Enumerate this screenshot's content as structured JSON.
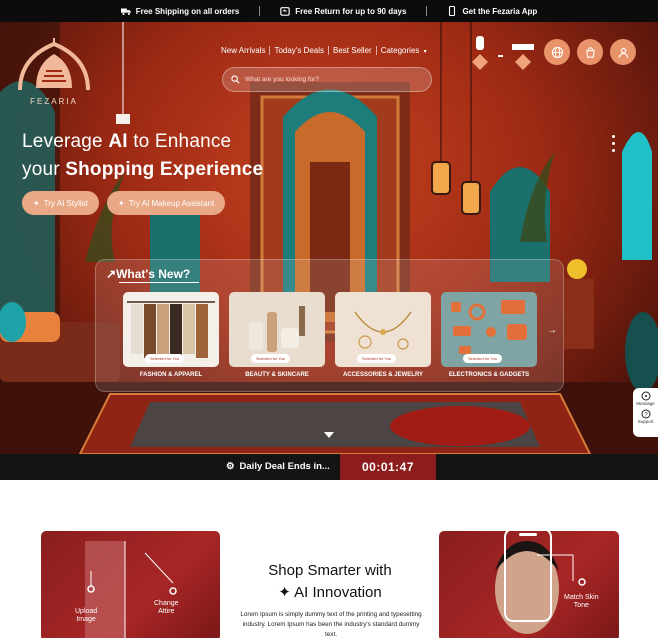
{
  "topbar": {
    "items": [
      {
        "label": "Free Shipping on all orders",
        "icon": "truck-icon"
      },
      {
        "label": "Free Return for up to 90 days",
        "icon": "return-box-icon"
      },
      {
        "label": "Get the Fezaria App",
        "icon": "phone-icon"
      }
    ]
  },
  "brand": {
    "name": "FEZARIA"
  },
  "nav": {
    "items": [
      "New Arrivals",
      "Today's Deals",
      "Best Seller",
      "Categories"
    ]
  },
  "search": {
    "placeholder": "What are you looking for?"
  },
  "hero": {
    "line1_pre": "Leverage ",
    "line1_bold": "AI",
    "line1_post": " to Enhance",
    "line2_pre": "your ",
    "line2_bold": "Shopping Experience",
    "cta1": "Try AI Stylist",
    "cta2": "Try AI Makeup Assistant"
  },
  "whats_new": {
    "title": "What's New?",
    "cards": [
      {
        "label": "FASHION & APPAREL",
        "tag": "Selected for You"
      },
      {
        "label": "BEAUTY & SKINCARE",
        "tag": "Selected for You"
      },
      {
        "label": "ACCESSORIES & JEWELRY",
        "tag": "Selected for You"
      },
      {
        "label": "ELECTRONICS & GADGETS",
        "tag": "Selected for You"
      }
    ]
  },
  "side": {
    "message": "Message",
    "support": "Support"
  },
  "deal": {
    "label": "Daily Deal Ends in...",
    "timer": "00:01:47"
  },
  "lower": {
    "upload": "Upload\nImage",
    "change": "Change\nAttire",
    "title_line1": "Shop Smarter with",
    "title_line2": "AI Innovation",
    "body": "Lorem Ipsum is simply dummy text of the printing and typesetting industry. Lorem Ipsum has been the industry's standard dummy text.",
    "match": "Match Skin\nTone"
  },
  "colors": {
    "accent": "#e9a987",
    "deal_red": "#8d1c1c",
    "panel_red": "#a82626"
  }
}
